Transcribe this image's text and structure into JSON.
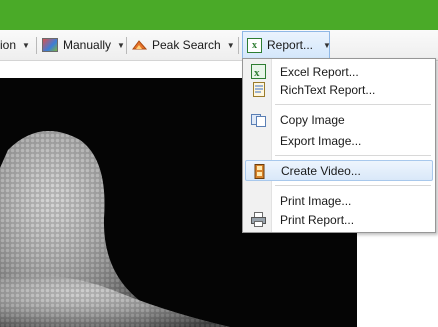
{
  "toolbar": {
    "partial_label": "ion",
    "manually_label": "Manually",
    "peak_search_label": "Peak Search",
    "report_label": "Report..."
  },
  "report_menu": {
    "items": [
      {
        "label": "Excel Report...",
        "icon": "excel-icon"
      },
      {
        "label": "RichText Report...",
        "icon": "richtext-icon"
      },
      {
        "label": "Copy Image",
        "icon": "copy-icon"
      },
      {
        "label": "Export Image...",
        "icon": ""
      },
      {
        "label": "Create Video...",
        "icon": "video-icon",
        "highlighted": true
      },
      {
        "label": "Print Image...",
        "icon": ""
      },
      {
        "label": "Print Report...",
        "icon": "printer-icon"
      }
    ]
  },
  "colors": {
    "titlebar": "#4aaa28",
    "menu_highlight": "#d9e8f9"
  }
}
